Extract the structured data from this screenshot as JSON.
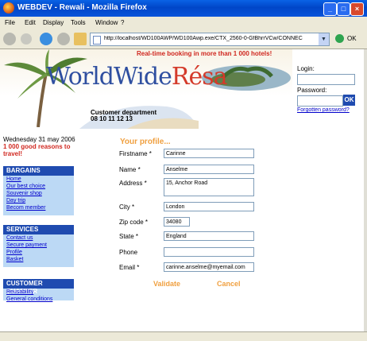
{
  "window": {
    "title": "WEBDEV - Rewali - Mozilla Firefox"
  },
  "menu": [
    "File",
    "Edit",
    "Display",
    "Tools",
    "Window",
    "?"
  ],
  "address": {
    "url": "http://localhost/WD100AWP/WD100Awp.exe/CTX_2560-0-GfBhrrVCw/CONNEC",
    "go_label": "OK"
  },
  "header": {
    "tagline": "Real-time booking in more than 1 000 hotels!",
    "logo_main": "WorldWide",
    "logo_accent": "Résa",
    "customer_dept": "Customer department",
    "phone": "08 10 11 12 13"
  },
  "login": {
    "login_label": "Login:",
    "password_label": "Password:",
    "ok_label": "OK",
    "forgot_label": "Forgotten password?"
  },
  "left": {
    "date": "Wednesday 31 may 2006",
    "reasons": "1 000 good reasons to travel!",
    "panels": [
      {
        "title": "BARGAINS",
        "links": [
          "Home",
          "Our best choice",
          "Souvenir shop",
          "Day trip",
          "Becom member"
        ]
      },
      {
        "title": "SERVICES",
        "links": [
          "Contact us",
          "Secure payment",
          "Profile",
          "Basket"
        ]
      },
      {
        "title": "CUSTOMER CHARTER",
        "links": [
          "Reusability",
          "General conditions"
        ]
      }
    ]
  },
  "form": {
    "title": "Your profile...",
    "fields": {
      "firstname": {
        "label": "Firstname *",
        "value": "Carinne"
      },
      "name": {
        "label": "Name *",
        "value": "Anselme"
      },
      "address": {
        "label": "Address *",
        "value": "15, Anchor Road"
      },
      "city": {
        "label": "City *",
        "value": "London"
      },
      "zip": {
        "label": "Zip code *",
        "value": "34080"
      },
      "state": {
        "label": "State *",
        "value": "England"
      },
      "phone": {
        "label": "Phone",
        "value": ""
      },
      "email": {
        "label": "Email *",
        "value": "carinne.anselme@myemail.com"
      }
    },
    "validate_label": "Validate",
    "cancel_label": "Cancel"
  },
  "colors": {
    "accent": "#f0a040",
    "nav": "#1f4bb0",
    "panel": "#bcd9f5",
    "alert": "#d02820"
  }
}
